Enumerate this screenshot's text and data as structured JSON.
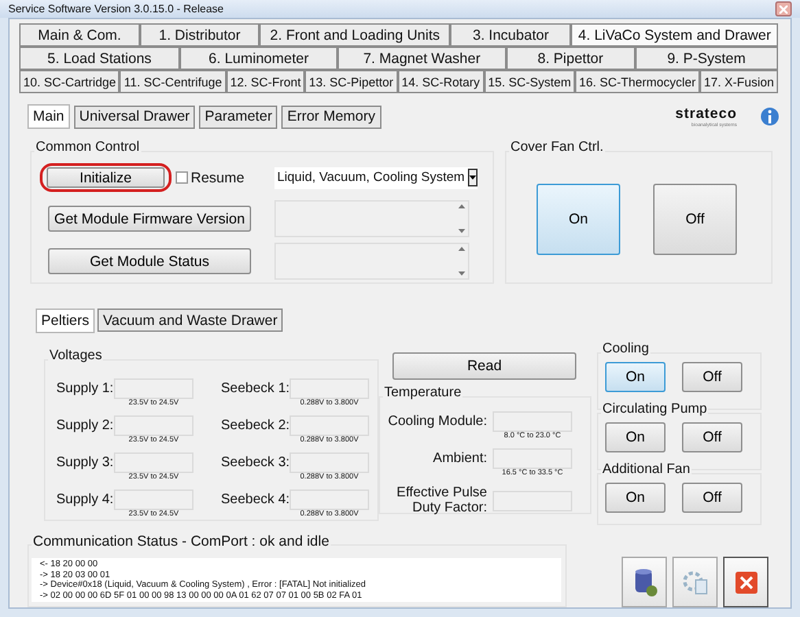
{
  "window": {
    "title": "Service Software Version 3.0.15.0 - Release"
  },
  "tab_rows": [
    [
      {
        "label": "Main & Com.",
        "selected": false
      },
      {
        "label": "1. Distributor",
        "selected": false
      },
      {
        "label": "2. Front and Loading Units",
        "selected": false
      },
      {
        "label": "3. Incubator",
        "selected": false
      },
      {
        "label": "4. LiVaCo System and Drawer",
        "selected": true
      }
    ],
    [
      {
        "label": "5. Load Stations",
        "selected": false
      },
      {
        "label": "6. Luminometer",
        "selected": false
      },
      {
        "label": "7. Magnet Washer",
        "selected": false
      },
      {
        "label": "8. Pipettor",
        "selected": false
      },
      {
        "label": "9. P-System",
        "selected": false
      }
    ],
    [
      {
        "label": "10. SC-Cartridge",
        "selected": false
      },
      {
        "label": "11. SC-Centrifuge",
        "selected": false
      },
      {
        "label": "12. SC-Front",
        "selected": false
      },
      {
        "label": "13. SC-Pipettor",
        "selected": false
      },
      {
        "label": "14. SC-Rotary",
        "selected": false
      },
      {
        "label": "15. SC-System",
        "selected": false
      },
      {
        "label": "16. SC-Thermocycler",
        "selected": false
      },
      {
        "label": "17. X-Fusion",
        "selected": false
      }
    ]
  ],
  "sub_tabs": [
    {
      "label": "Main",
      "selected": true
    },
    {
      "label": "Universal Drawer",
      "selected": false
    },
    {
      "label": "Parameter",
      "selected": false
    },
    {
      "label": "Error Memory",
      "selected": false
    }
  ],
  "logo": {
    "text": "strateco",
    "tagline": "bioanalytical systems"
  },
  "common_control": {
    "title": "Common Control",
    "initialize": {
      "label": "Initialize",
      "highlighted": true
    },
    "resume": {
      "label": "Resume",
      "checked": false
    },
    "module_select": {
      "value": "Liquid, Vacuum, Cooling System"
    },
    "firmware_button": "Get Module Firmware Version",
    "status_button": "Get Module Status"
  },
  "cover_fan": {
    "title": "Cover Fan Ctrl.",
    "buttons": [
      {
        "label": "On",
        "selected": true
      },
      {
        "label": "Off",
        "selected": false
      }
    ]
  },
  "inner_tabs": [
    {
      "label": "Peltiers",
      "selected": true
    },
    {
      "label": "Vacuum and Waste Drawer",
      "selected": false
    }
  ],
  "voltages": {
    "title": "Voltages",
    "rows": [
      {
        "supply": "Supply 1:",
        "supply_range": "23.5V to 24.5V",
        "seebeck": "Seebeck 1:",
        "seebeck_range": "0.288V to 3.800V"
      },
      {
        "supply": "Supply 2:",
        "supply_range": "23.5V to 24.5V",
        "seebeck": "Seebeck 2:",
        "seebeck_range": "0.288V to 3.800V"
      },
      {
        "supply": "Supply 3:",
        "supply_range": "23.5V to 24.5V",
        "seebeck": "Seebeck 3:",
        "seebeck_range": "0.288V to 3.800V"
      },
      {
        "supply": "Supply 4:",
        "supply_range": "23.5V to 24.5V",
        "seebeck": "Seebeck 4:",
        "seebeck_range": "0.288V to 3.800V"
      }
    ]
  },
  "read_button": "Read",
  "temperature": {
    "title": "Temperature",
    "rows": [
      {
        "label": "Cooling Module:",
        "range": "8.0 °C to 23.0 °C"
      },
      {
        "label": "Ambient:",
        "range": "16.5 °C to 33.5 °C"
      }
    ],
    "duty_label": "Effective Pulse Duty Factor:"
  },
  "switch_groups": [
    {
      "title": "Cooling",
      "buttons": [
        {
          "label": "On",
          "selected": true
        },
        {
          "label": "Off",
          "selected": false
        }
      ]
    },
    {
      "title": "Circulating Pump",
      "buttons": [
        {
          "label": "On",
          "selected": false
        },
        {
          "label": "Off",
          "selected": false
        }
      ]
    },
    {
      "title": "Additional Fan",
      "buttons": [
        {
          "label": "On",
          "selected": false
        },
        {
          "label": "Off",
          "selected": false
        }
      ]
    }
  ],
  "communication": {
    "title": "Communication Status - ComPort : ok and idle",
    "log": [
      "<- 18 20 00 00",
      "-> 18 20 03 00 01",
      "-> Device#0x18 (Liquid, Vacuum & Cooling System) , Error : [FATAL] Not initialized",
      "-> 02 00 00 00 6D 5F 01 00 00 98 13 00 00 00 0A 01 62 07 07 01 00 5B 02 FA 01"
    ]
  }
}
